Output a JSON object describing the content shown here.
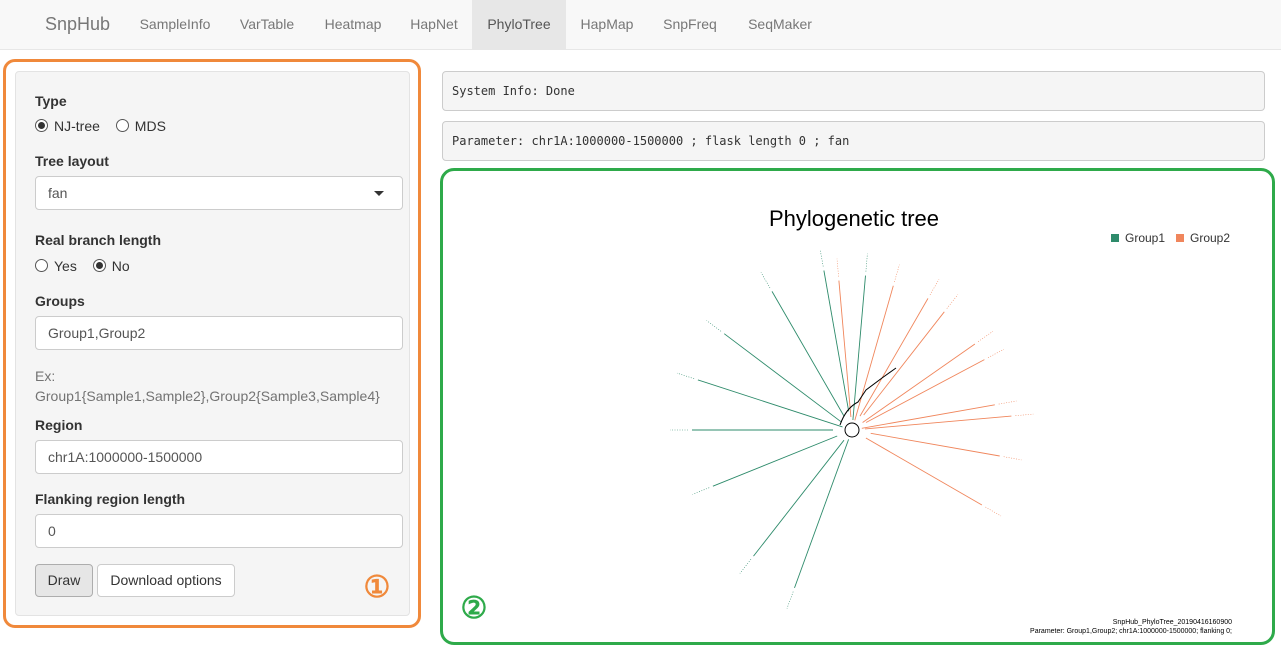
{
  "navbar": {
    "brand": "SnpHub",
    "tabs": [
      "SampleInfo",
      "VarTable",
      "Heatmap",
      "HapNet",
      "PhyloTree",
      "HapMap",
      "SnpFreq",
      "SeqMaker"
    ],
    "active_tab": "PhyloTree"
  },
  "form": {
    "type_label": "Type",
    "type_options": [
      "NJ-tree",
      "MDS"
    ],
    "type_selected": "NJ-tree",
    "layout_label": "Tree layout",
    "layout_value": "fan",
    "branch_label": "Real branch length",
    "branch_options": [
      "Yes",
      "No"
    ],
    "branch_selected": "No",
    "groups_label": "Groups",
    "groups_value": "Group1,Group2",
    "groups_help_1": "Ex:",
    "groups_help_2": "Group1{Sample1,Sample2},Group2{Sample3,Sample4}",
    "region_label": "Region",
    "region_value": "chr1A:1000000-1500000",
    "flank_label": "Flanking region length",
    "flank_value": "0",
    "draw_label": "Draw",
    "download_label": "Download options"
  },
  "annotations": {
    "left_number": "①",
    "right_number": "②"
  },
  "status": {
    "system_info": "System Info: Done",
    "parameter": "Parameter: chr1A:1000000-1500000 ; flask length 0 ; fan"
  },
  "plot": {
    "title": "Phylogenetic tree",
    "legend": [
      {
        "name": "Group1",
        "color": "#2e8b6b"
      },
      {
        "name": "Group2",
        "color": "#f0865c"
      }
    ],
    "footer_1": "SnpHub_PhyloTree_20190416160900",
    "footer_2": "Parameter: Group1,Group2; chr1A:1000000-1500000; flanking 0;"
  },
  "colors": {
    "highlight_left": "#f0893b",
    "highlight_right": "#2eaa4a"
  }
}
